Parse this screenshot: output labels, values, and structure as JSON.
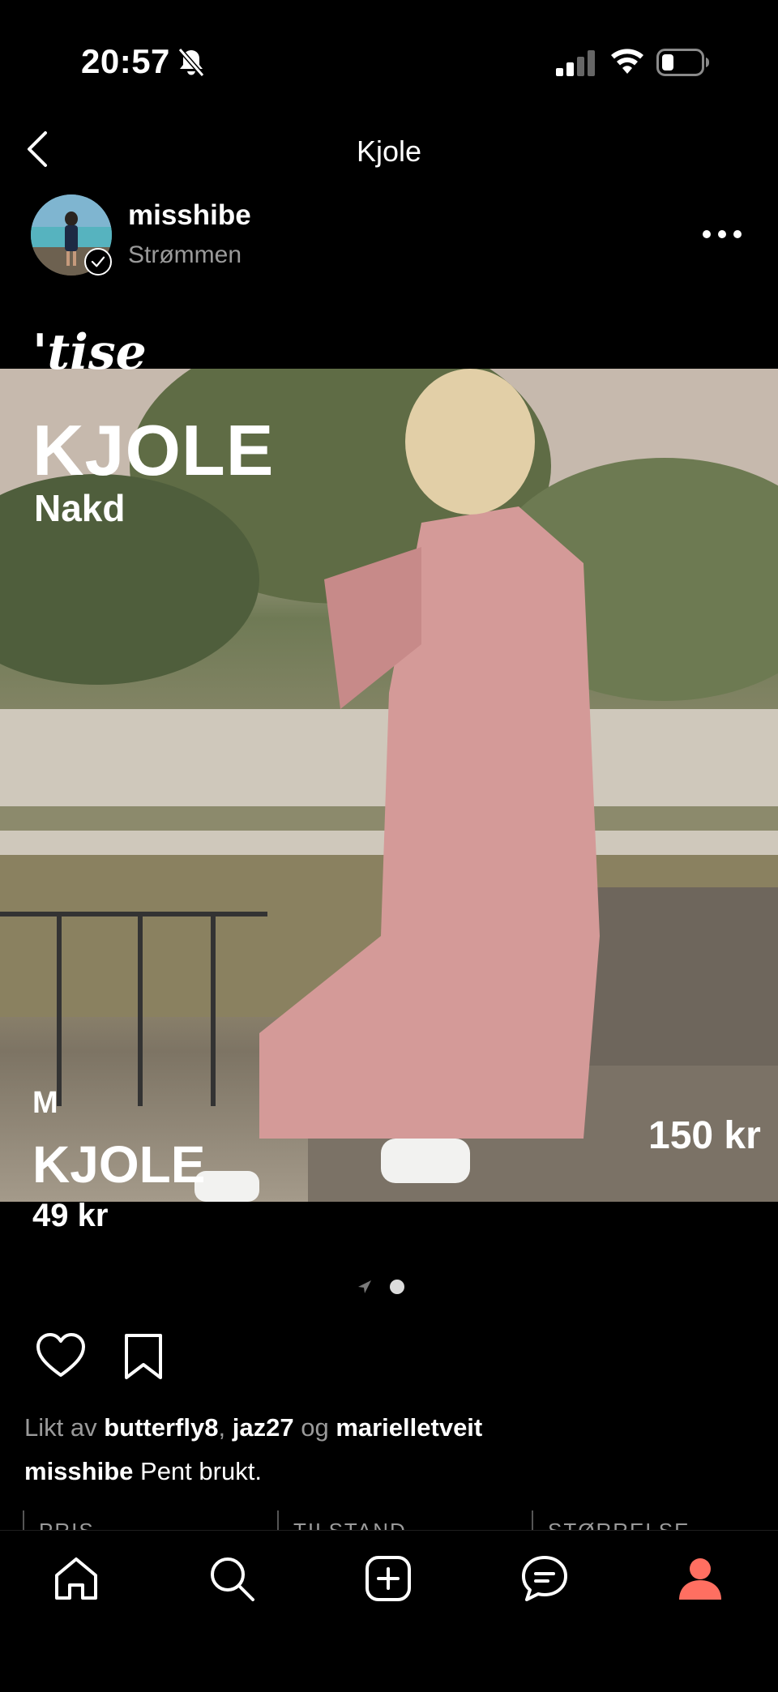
{
  "status_bar": {
    "time": "20:57"
  },
  "header": {
    "title": "Kjole"
  },
  "user": {
    "username": "misshibe",
    "subtitle": "Strømmen"
  },
  "post_overlay": {
    "brand_logo": "'tise",
    "title": "KJOLE",
    "brand": "Nakd",
    "size": "M",
    "title_bottom": "KJOLE",
    "price_left": "49 kr",
    "price_right": "150 kr"
  },
  "pager": {
    "total": 2,
    "current": 2
  },
  "likes": {
    "prefix": "Likt av",
    "user1": "butterfly8",
    "sep": ",",
    "user2": "jaz27",
    "conj": "og",
    "user3": "marielletveit"
  },
  "caption": {
    "user": "misshibe",
    "text": "Pent brukt."
  },
  "details": {
    "col1": "PRIS",
    "col2": "TILSTAND",
    "col3": "STØRRELSE"
  },
  "icons": {
    "back": "chevron-left-icon",
    "more": "more-horizontal-icon",
    "like": "heart-icon",
    "save": "bookmark-icon",
    "tabs": [
      "home-icon",
      "search-icon",
      "add-icon",
      "messages-icon",
      "profile-icon"
    ]
  },
  "colors": {
    "profile_active": "#FF6F61",
    "muted_text": "#9a9a9a"
  }
}
